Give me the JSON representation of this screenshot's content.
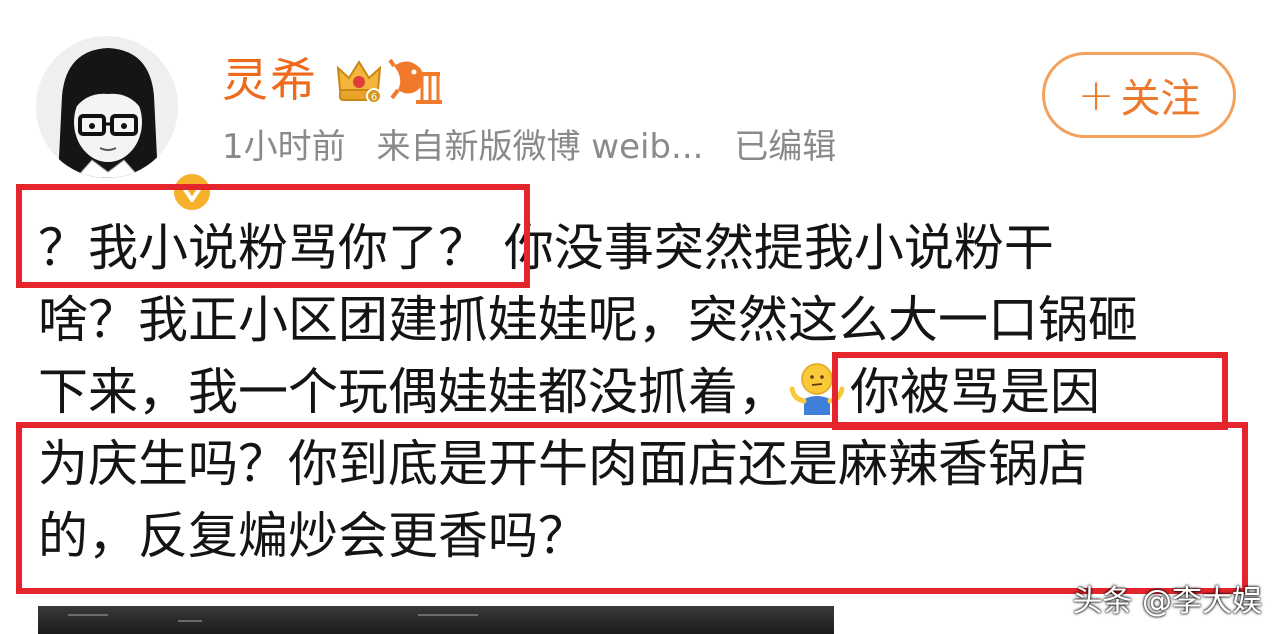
{
  "user": {
    "name": "灵希",
    "avatar_icon": "avatar-girl-glasses-icon",
    "verified_icon": "verified-v-icon",
    "badges": [
      "crown-badge-icon",
      "fish-badge-icon"
    ]
  },
  "meta": {
    "time": "1小时前",
    "source": "来自新版微博 weib...",
    "edited": "已编辑"
  },
  "follow_button": {
    "icon": "+",
    "label": "关注"
  },
  "post": {
    "lines": [
      "？我小说粉骂你了？ 你没事突然提我小说粉干",
      "啥？我正小区团建抓娃娃呢，突然这么大一口锅砸",
      "下来，我一个玩偶娃娃都没抓着，",
      "为庆生吗？你到底是开牛肉面店还是麻辣香锅店",
      "的，反复煸炒会更香吗？"
    ],
    "line3_after_emoji": "你被骂是因",
    "emoji_icon": "shrug-emoji-icon"
  },
  "watermark": "头条 @李大娱",
  "colors": {
    "username": "#ee6a1c",
    "highlight_border": "#e4252c",
    "follow_border": "#f2a15e",
    "meta_text": "#8a8a8a"
  }
}
